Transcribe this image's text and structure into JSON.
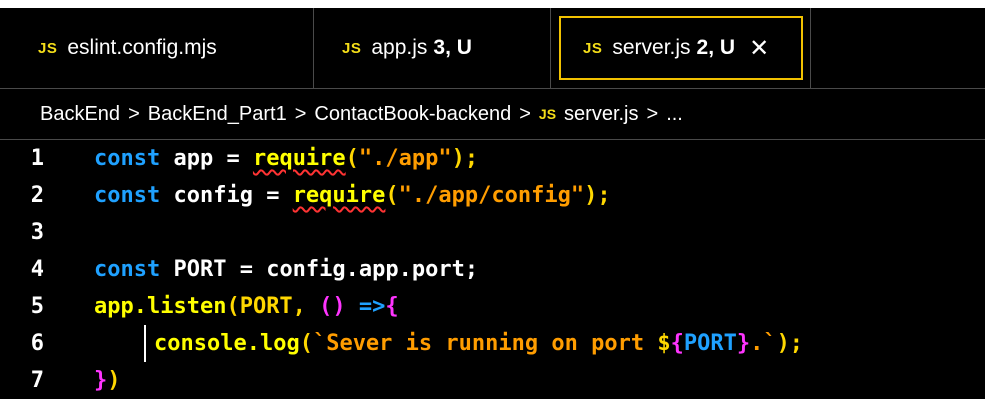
{
  "tabs": [
    {
      "icon": "JS",
      "label": "eslint.config.mjs",
      "badge": "",
      "close": ""
    },
    {
      "icon": "JS",
      "label": "app.js",
      "badge": "3, U",
      "close": ""
    },
    {
      "icon": "JS",
      "label": "server.js",
      "badge": "2, U",
      "close": "✕"
    }
  ],
  "breadcrumb": {
    "parts": [
      "BackEnd",
      "BackEnd_Part1",
      "ContactBook-backend"
    ],
    "file_icon": "JS",
    "file": "server.js",
    "sep": ">",
    "ellipsis": "..."
  },
  "editor": {
    "line_numbers": [
      "1",
      "2",
      "3",
      "4",
      "5",
      "6",
      "7"
    ],
    "lines": {
      "l1": {
        "kw": "const",
        "rest": " app = ",
        "fn": "require",
        "p1": "(",
        "str": "\"./app\"",
        "p2": ");"
      },
      "l2": {
        "kw": "const",
        "rest": " config = ",
        "fn": "require",
        "p1": "(",
        "str": "\"./app/config\"",
        "p2": ");"
      },
      "l4": {
        "kw": "const",
        "rest": " PORT = config.app.port;"
      },
      "l5": {
        "a": "app.listen",
        "b": "(PORT, ",
        "c": "()",
        "d": " =>",
        "e": "{"
      },
      "l6": {
        "a": "console.log",
        "b": "(",
        "s1": "`Sever is running on port ",
        "dollar": "$",
        "ob": "{",
        "v": "PORT",
        "cb": "}",
        "s2": ".`",
        "c": ");"
      },
      "l7": {
        "a": "}",
        "b": ")"
      }
    }
  },
  "colors": {
    "keyword": "#1fa1ff",
    "function": "#ffff00",
    "string": "#ff9d00",
    "js_icon": "#f5de19",
    "active_tab_outline": "#f2c200",
    "error": "#ff3333"
  }
}
